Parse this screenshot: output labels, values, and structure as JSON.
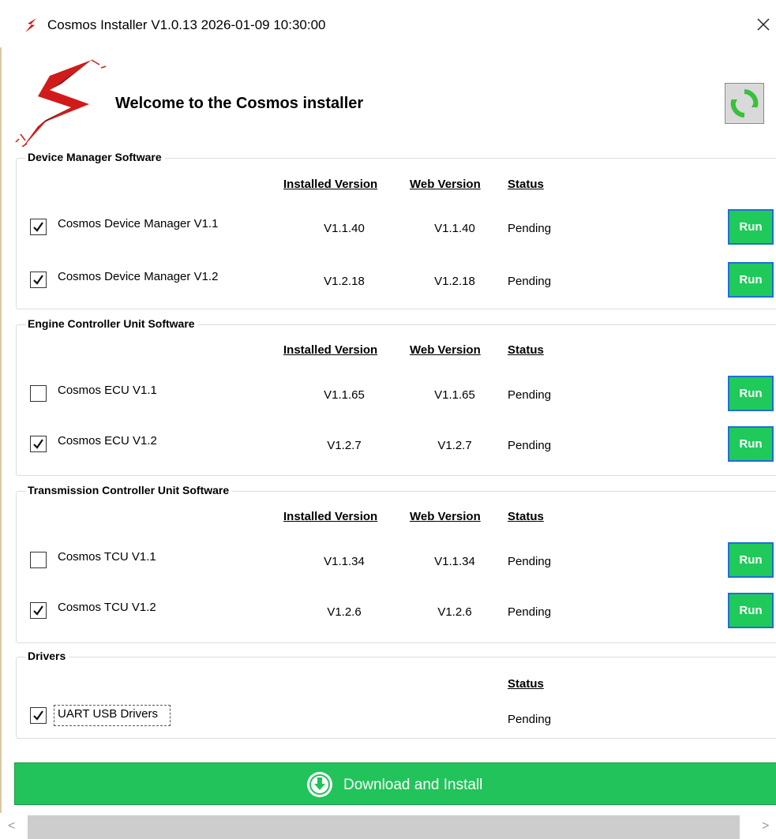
{
  "window": {
    "title": "Cosmos Installer V1.0.13 2026-01-09 10:30:00"
  },
  "header": {
    "welcome": "Welcome to the Cosmos installer",
    "logo_icon": "lightning-bolt-logo",
    "refresh_icon": "refresh-icon"
  },
  "columns": {
    "installed": "Installed Version",
    "web": "Web Version",
    "status": "Status"
  },
  "groups": {
    "device_manager": {
      "title": "Device Manager Software",
      "items": [
        {
          "name": "Cosmos Device Manager V1.1",
          "checked": true,
          "installed": "V1.1.40",
          "web": "V1.1.40",
          "status": "Pending",
          "action": "Run"
        },
        {
          "name": "Cosmos Device Manager V1.2",
          "checked": true,
          "installed": "V1.2.18",
          "web": "V1.2.18",
          "status": "Pending",
          "action": "Run"
        }
      ]
    },
    "ecu": {
      "title": "Engine Controller Unit Software",
      "items": [
        {
          "name": "Cosmos ECU V1.1",
          "checked": false,
          "installed": "V1.1.65",
          "web": "V1.1.65",
          "status": "Pending",
          "action": "Run"
        },
        {
          "name": "Cosmos ECU V1.2",
          "checked": true,
          "installed": "V1.2.7",
          "web": "V1.2.7",
          "status": "Pending",
          "action": "Run"
        }
      ]
    },
    "tcu": {
      "title": "Transmission Controller Unit Software",
      "items": [
        {
          "name": "Cosmos TCU V1.1",
          "checked": false,
          "installed": "V1.1.34",
          "web": "V1.1.34",
          "status": "Pending",
          "action": "Run"
        },
        {
          "name": "Cosmos TCU V1.2",
          "checked": true,
          "installed": "V1.2.6",
          "web": "V1.2.6",
          "status": "Pending",
          "action": "Run"
        }
      ]
    },
    "drivers": {
      "title": "Drivers",
      "items": [
        {
          "name": "UART USB Drivers",
          "checked": true,
          "status": "Pending"
        }
      ]
    }
  },
  "footer": {
    "download_label": "Download and Install",
    "download_icon": "download-circle-icon"
  },
  "scrollbar": {
    "left_arrow": "<",
    "right_arrow": ">"
  },
  "colors": {
    "accent_green": "#22c35a",
    "run_border": "#1e6fd6",
    "logo_red": "#d11a1a"
  }
}
